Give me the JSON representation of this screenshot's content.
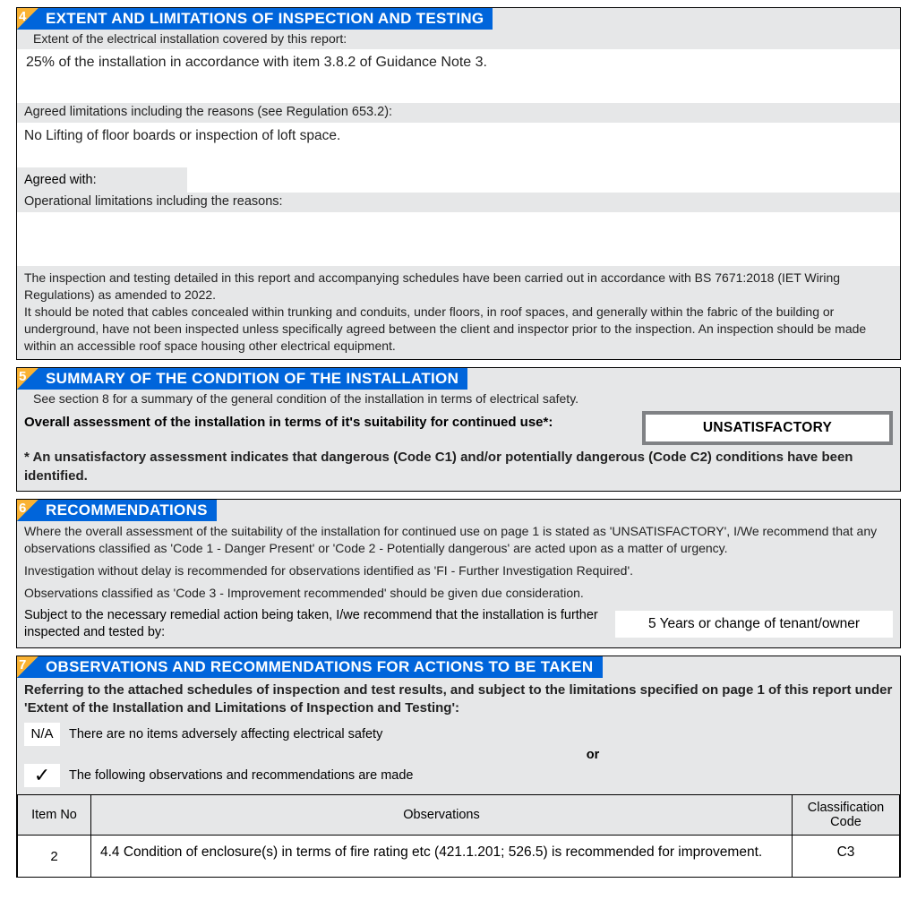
{
  "section4": {
    "num": "4",
    "title": "EXTENT AND LIMITATIONS OF INSPECTION AND TESTING",
    "extent_label": "Extent of the electrical installation covered by this report:",
    "extent_value": "25% of the installation  in accordance with item 3.8.2 of Guidance Note 3.",
    "limits_label": "Agreed limitations including the reasons (see Regulation 653.2):",
    "limits_value": "No Lifting of floor boards or inspection of loft space.",
    "agreed_with_label": "Agreed with:",
    "agreed_with_value": "",
    "op_limits_label": "Operational limitations including the reasons:",
    "op_limits_value": "",
    "notes": "The inspection and testing detailed in this report and accompanying schedules have been carried out in accordance with BS 7671:2018 (IET Wiring Regulations) as amended to 2022.\nIt should be noted that cables concealed within trunking and conduits, under floors, in roof spaces, and generally within the fabric of the building or underground, have not been inspected unless specifically agreed between the client and inspector prior to the inspection. An inspection should be made within an accessible roof space housing other electrical equipment."
  },
  "section5": {
    "num": "5",
    "title": "SUMMARY OF THE CONDITION OF THE INSTALLATION",
    "subhead": "See section 8 for a summary of the general condition of the installation in terms of electrical safety.",
    "assess_label": "Overall assessment of the installation in terms of it's suitability for continued use*:",
    "assess_value": "UNSATISFACTORY",
    "footnote": "* An unsatisfactory assessment indicates that dangerous (Code C1) and/or potentially dangerous (Code C2) conditions have been identified."
  },
  "section6": {
    "num": "6",
    "title": "RECOMMENDATIONS",
    "para1": "Where the overall assessment of the suitability of the installation for continued use on page 1 is stated as 'UNSATISFACTORY', I/We recommend that any observations classified as 'Code 1 - Danger Present' or 'Code 2 - Potentially dangerous' are acted upon as a matter of urgency.",
    "para2": "Investigation without delay is recommended for observations identified as 'FI - Further Investigation Required'.",
    "para3": "Observations classified as 'Code 3 - Improvement recommended' should be given due consideration.",
    "rec_label": "Subject to the necessary remedial action being taken, I/we recommend that the installation is further inspected and tested by:",
    "rec_value": "5 Years or change of tenant/owner"
  },
  "section7": {
    "num": "7",
    "title": "OBSERVATIONS AND RECOMMENDATIONS FOR ACTIONS TO BE TAKEN",
    "intro": "Referring to the attached schedules of inspection and test results, and subject to the limitations specified on page 1 of this report under 'Extent of the Installation and Limitations of Inspection and Testing':",
    "opt1_check": "N/A",
    "opt1_label": "There are no items adversely affecting electrical safety",
    "or": "or",
    "opt2_check": "✓",
    "opt2_label": "The following observations and recommendations are made",
    "col_item": "Item No",
    "col_obs": "Observations",
    "col_class": "Classification Code",
    "rows": [
      {
        "item": "2",
        "obs": "4.4 Condition of enclosure(s) in terms of fire rating etc (421.1.201; 526.5) is recommended for improvement.",
        "code": "C3"
      }
    ]
  }
}
